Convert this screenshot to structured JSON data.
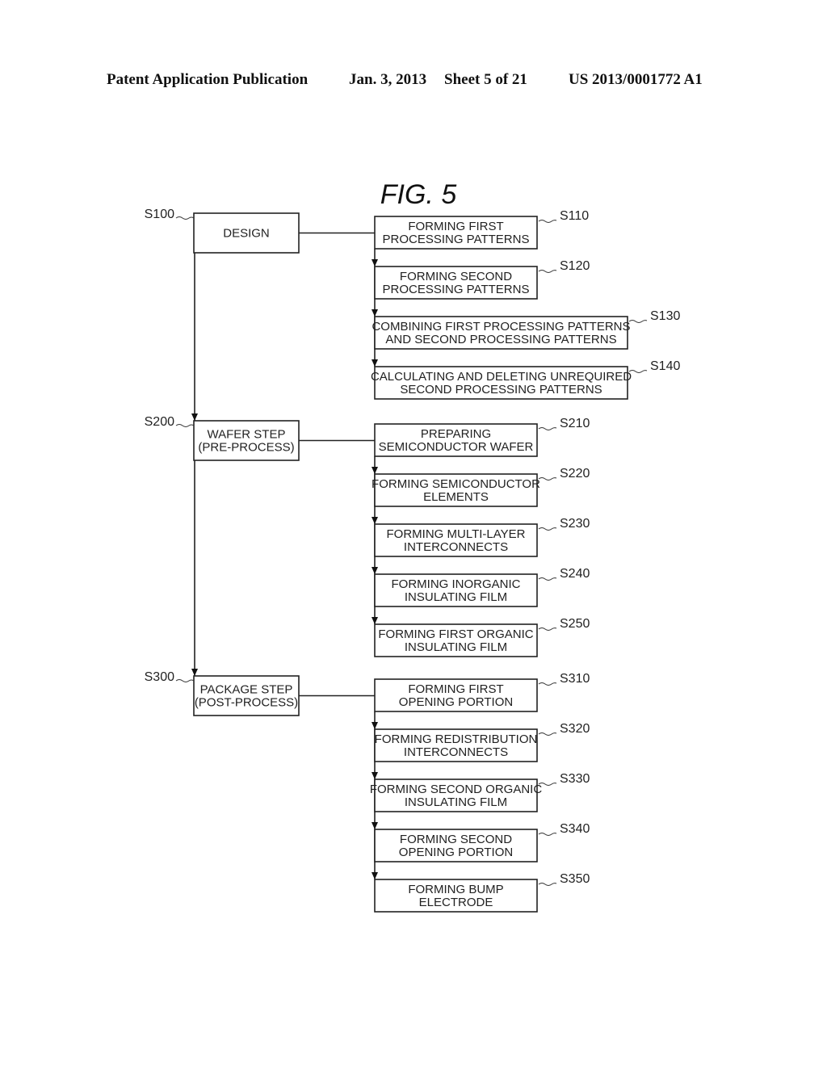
{
  "header": {
    "publication": "Patent Application Publication",
    "date": "Jan. 3, 2013",
    "sheet": "Sheet 5 of 21",
    "number": "US 2013/0001772 A1"
  },
  "figure": {
    "title": "FIG.  5"
  },
  "flow": {
    "main_steps": [
      {
        "id": "S100",
        "lines": [
          "DESIGN"
        ],
        "sub_steps": [
          {
            "id": "S110",
            "lines": [
              "FORMING FIRST",
              "PROCESSING PATTERNS"
            ]
          },
          {
            "id": "S120",
            "lines": [
              "FORMING SECOND",
              "PROCESSING PATTERNS"
            ]
          },
          {
            "id": "S130",
            "lines": [
              "COMBINING FIRST PROCESSING PATTERNS",
              "AND SECOND PROCESSING PATTERNS"
            ]
          },
          {
            "id": "S140",
            "lines": [
              "CALCULATING AND DELETING UNREQUIRED",
              "SECOND PROCESSING PATTERNS"
            ]
          }
        ]
      },
      {
        "id": "S200",
        "lines": [
          "WAFER STEP",
          "(PRE-PROCESS)"
        ],
        "sub_steps": [
          {
            "id": "S210",
            "lines": [
              "PREPARING",
              "SEMICONDUCTOR WAFER"
            ]
          },
          {
            "id": "S220",
            "lines": [
              "FORMING SEMICONDUCTOR",
              "ELEMENTS"
            ]
          },
          {
            "id": "S230",
            "lines": [
              "FORMING MULTI-LAYER",
              "INTERCONNECTS"
            ]
          },
          {
            "id": "S240",
            "lines": [
              "FORMING INORGANIC",
              "INSULATING FILM"
            ]
          },
          {
            "id": "S250",
            "lines": [
              "FORMING FIRST ORGANIC",
              "INSULATING FILM"
            ]
          }
        ]
      },
      {
        "id": "S300",
        "lines": [
          "PACKAGE STEP",
          "(POST-PROCESS)"
        ],
        "sub_steps": [
          {
            "id": "S310",
            "lines": [
              "FORMING FIRST",
              "OPENING PORTION"
            ]
          },
          {
            "id": "S320",
            "lines": [
              "FORMING REDISTRIBUTION",
              "INTERCONNECTS"
            ]
          },
          {
            "id": "S330",
            "lines": [
              "FORMING SECOND ORGANIC",
              "INSULATING FILM"
            ]
          },
          {
            "id": "S340",
            "lines": [
              "FORMING SECOND",
              "OPENING PORTION"
            ]
          },
          {
            "id": "S350",
            "lines": [
              "FORMING BUMP",
              "ELECTRODE"
            ]
          }
        ]
      }
    ]
  }
}
